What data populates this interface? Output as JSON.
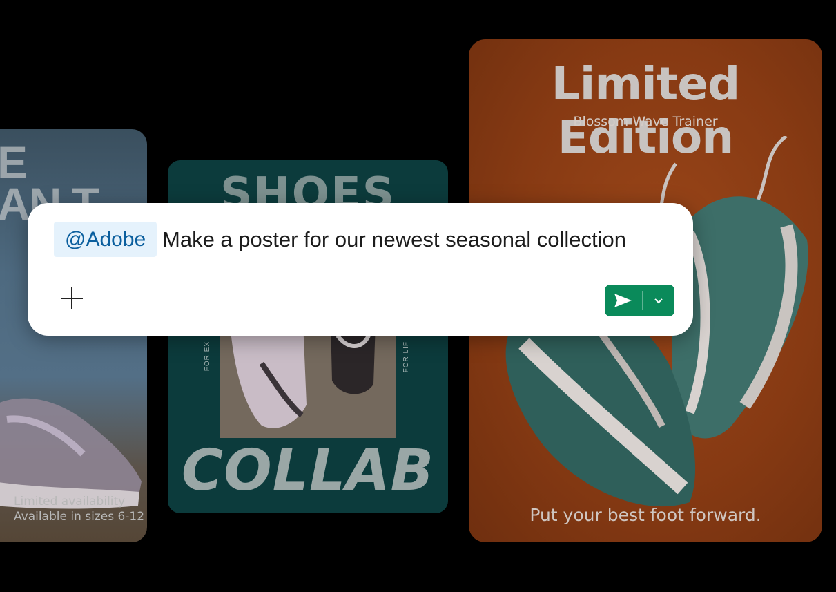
{
  "cards": {
    "left": {
      "letters_line1": "E",
      "letters_line2": "AN T",
      "caption_line1": "Limited availability",
      "caption_line2": "Available in sizes 6-12"
    },
    "middle": {
      "top_title": "SHOES",
      "side_left": "FOR EX",
      "side_right": "FOR LIF",
      "bottom_title": "COLLAB"
    },
    "right": {
      "headline": "Limited Edition",
      "subhead": "Blossom Wave Trainer",
      "tagline": "Put your best foot forward."
    }
  },
  "prompt": {
    "mention": "@Adobe",
    "text": "Make a poster for our newest seasonal collection"
  },
  "icons": {
    "add": "plus-icon",
    "send": "send-arrow-icon",
    "dropdown": "chevron-down-icon"
  },
  "colors": {
    "send_button": "#0a8a5a",
    "mention_chip_bg": "#e5f2fc",
    "mention_chip_text": "#0b5f9e",
    "right_card_bg": "#8a3a13",
    "middle_card_bg": "#0c3b3c"
  }
}
